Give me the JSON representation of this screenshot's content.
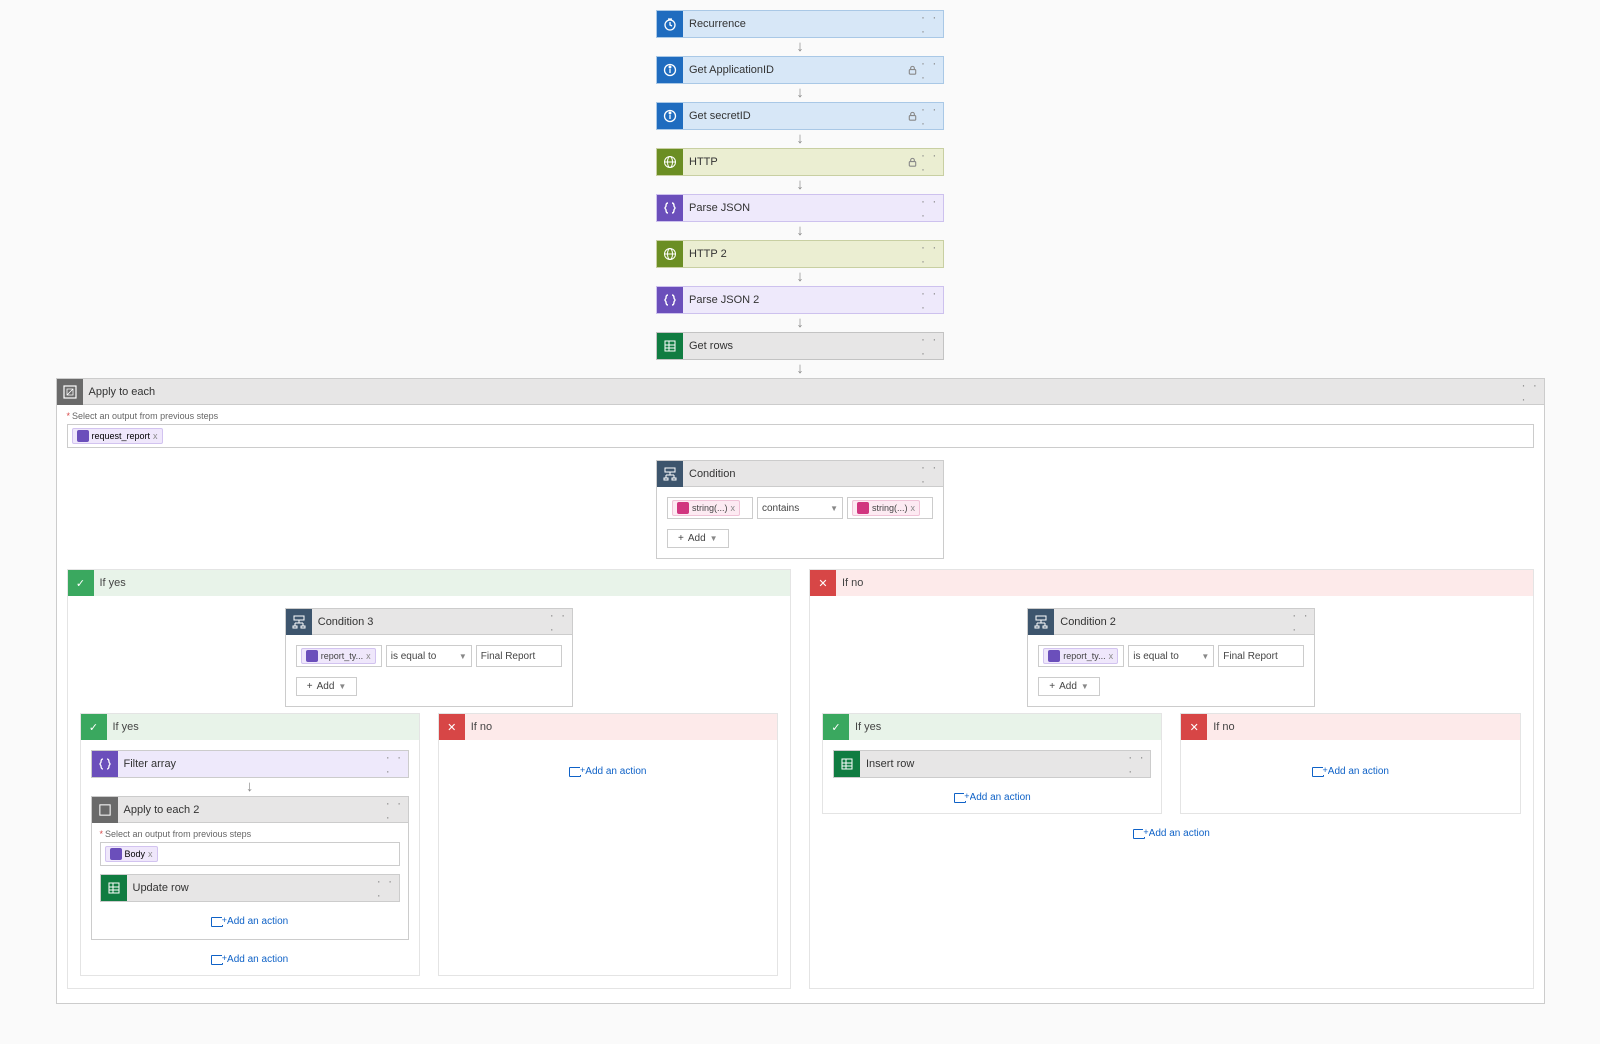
{
  "steps": [
    {
      "label": "Recurrence",
      "theme": "blue",
      "lock": false,
      "iconSvg": "clock"
    },
    {
      "label": "Get ApplicationID",
      "theme": "blue",
      "lock": true,
      "iconSvg": "info"
    },
    {
      "label": "Get secretID",
      "theme": "blue",
      "lock": true,
      "iconSvg": "info"
    },
    {
      "label": "HTTP",
      "theme": "olive",
      "lock": true,
      "iconSvg": "globe"
    },
    {
      "label": "Parse JSON",
      "theme": "purple",
      "lock": false,
      "iconSvg": "braces"
    },
    {
      "label": "HTTP 2",
      "theme": "olive",
      "lock": false,
      "iconSvg": "globe"
    },
    {
      "label": "Parse JSON 2",
      "theme": "purple",
      "lock": false,
      "iconSvg": "braces"
    },
    {
      "label": "Get rows",
      "theme": "green",
      "lock": false,
      "iconSvg": "grid"
    }
  ],
  "apply_each": {
    "title": "Apply to each",
    "select_label": "Select an output from previous steps",
    "token": "request_report"
  },
  "condition": {
    "title": "Condition",
    "left": "string(...)",
    "op": "contains",
    "right": "string(...)",
    "add": "Add"
  },
  "yes": {
    "title": "If yes",
    "cond3": {
      "title": "Condition 3",
      "left": "report_ty...",
      "op": "is equal to",
      "right": "Final Report",
      "add": "Add"
    },
    "filter": "Filter array",
    "apply2": {
      "title": "Apply to each 2",
      "select_label": "Select an output from previous steps",
      "token": "Body",
      "update": "Update row"
    }
  },
  "no": {
    "title": "If no",
    "cond2": {
      "title": "Condition 2",
      "left": "report_ty...",
      "op": "is equal to",
      "right": "Final Report",
      "add": "Add"
    },
    "insert": "Insert row"
  },
  "add_action": "Add an action",
  "x": "x",
  "plus": "+",
  "ellipsis": "· · ·"
}
